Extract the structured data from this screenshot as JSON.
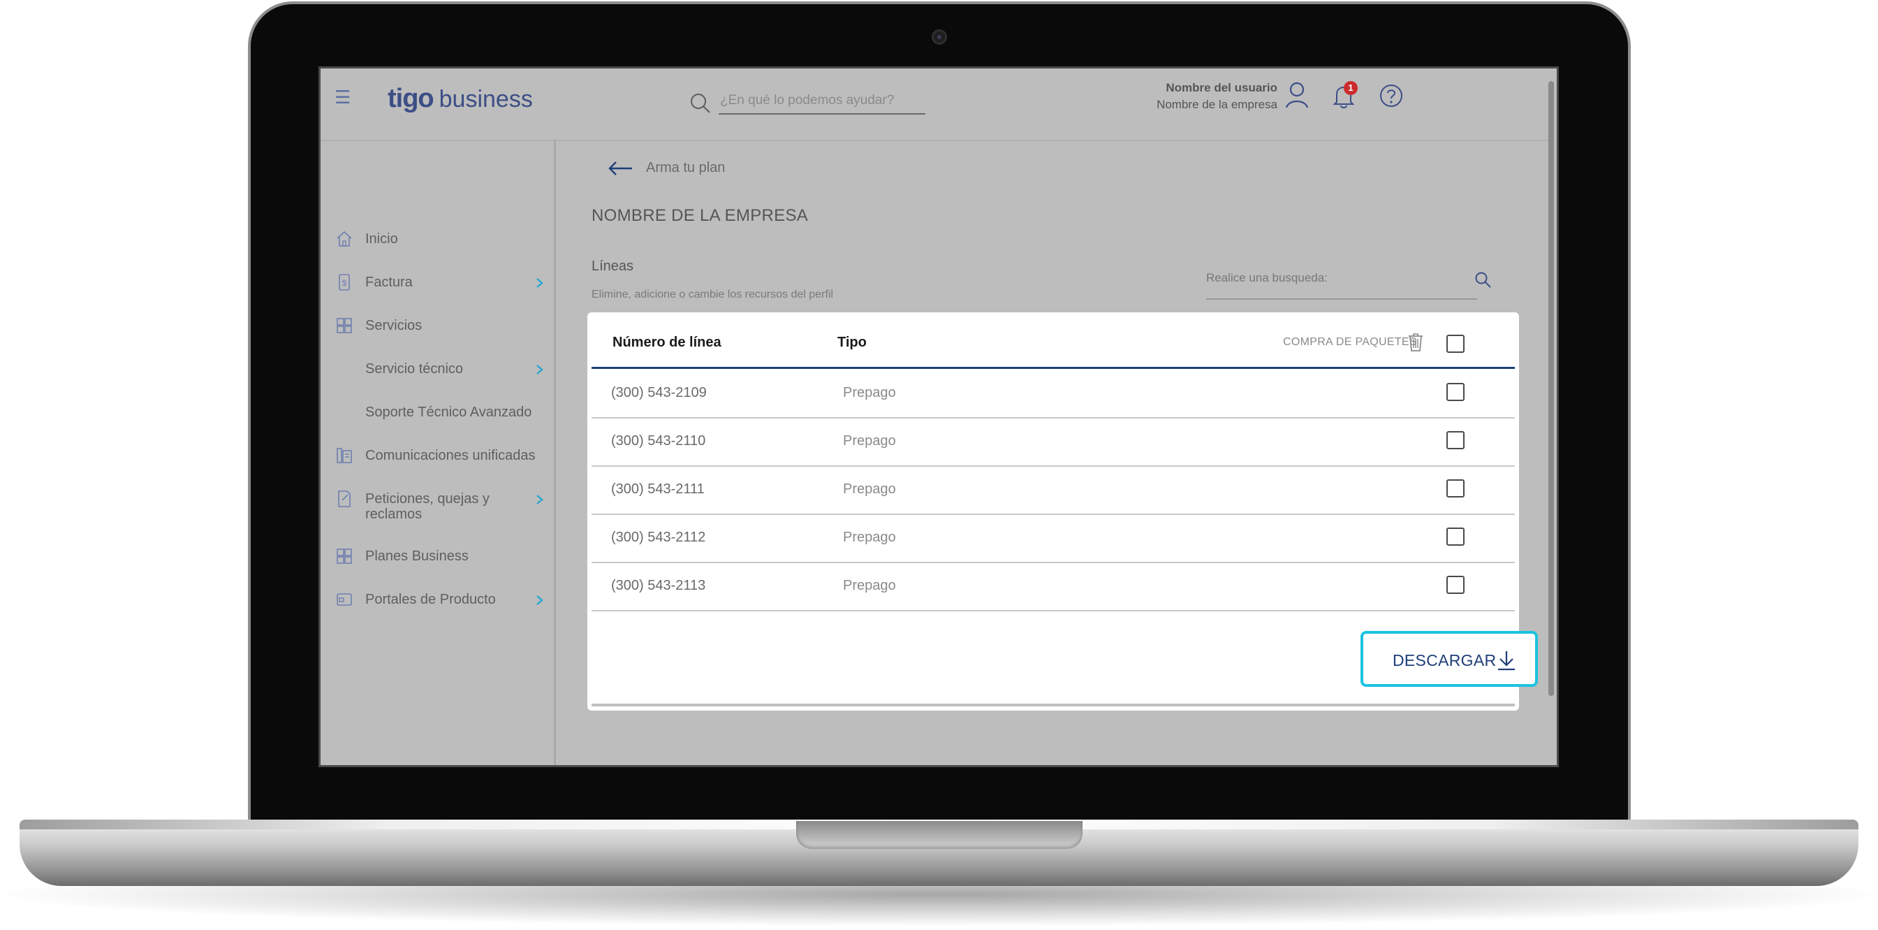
{
  "app": {
    "brand_main": "tigo",
    "brand_secondary": "business"
  },
  "header": {
    "search_placeholder": "¿En qué lo podemos ayudar?",
    "user_name": "Nombre del usuario",
    "company_name": "Nombre de la empresa",
    "notifications_count": "1"
  },
  "sidebar": {
    "items": [
      {
        "label": "Inicio",
        "icon": "home-icon",
        "has_chevron": false
      },
      {
        "label": "Factura",
        "icon": "invoice-icon",
        "has_chevron": true
      },
      {
        "label": "Servicios",
        "icon": "grid-icon",
        "has_chevron": false
      },
      {
        "label": "Servicio técnico",
        "icon": "",
        "has_chevron": true
      },
      {
        "label": "Soporte Técnico Avanzado",
        "icon": "",
        "has_chevron": false
      },
      {
        "label": "Comunicaciones unificadas",
        "icon": "phone-building-icon",
        "has_chevron": false
      },
      {
        "label": "Peticiones, quejas y reclamos",
        "icon": "document-edit-icon",
        "has_chevron": true
      },
      {
        "label": "Planes Business",
        "icon": "grid-icon",
        "has_chevron": false
      },
      {
        "label": "Portales de Producto",
        "icon": "card-icon",
        "has_chevron": true
      }
    ]
  },
  "main": {
    "breadcrumb": "Arma tu plan",
    "page_title": "NOMBRE DE LA EMPRESA",
    "section_title": "Líneas",
    "section_subtitle": "Elimine, adicione o cambie los recursos del perfil",
    "search_label": "Realice una busqueda:"
  },
  "table": {
    "col_number": "Número de línea",
    "col_type": "Tipo",
    "col_packages": "COMPRA DE PAQUETES",
    "rows": [
      {
        "number": "(300) 543-2109",
        "type": "Prepago"
      },
      {
        "number": "(300) 543-2110",
        "type": "Prepago"
      },
      {
        "number": "(300) 543-2111",
        "type": "Prepago"
      },
      {
        "number": "(300) 543-2112",
        "type": "Prepago"
      },
      {
        "number": "(300) 543-2113",
        "type": "Prepago"
      }
    ]
  },
  "actions": {
    "download_label": "DESCARGAR"
  },
  "colors": {
    "brand_blue": "#1f3e78",
    "accent_cyan": "#1ac3e0",
    "chevron_cyan": "#2aa7d0",
    "badge_red": "#cc2c2c"
  }
}
